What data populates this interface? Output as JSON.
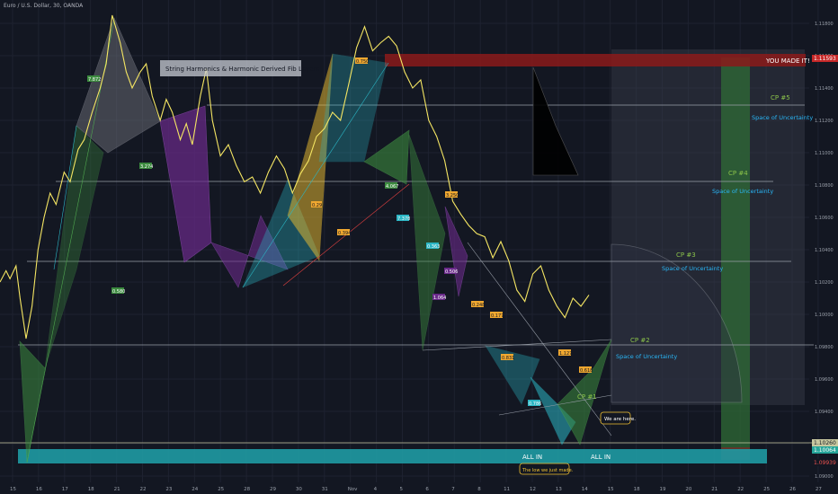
{
  "header": {
    "symbol_title": "Euro / U.S. Dollar, 30, OANDA"
  },
  "annotations": {
    "study_title": "String Harmonics & Harmonic Derived Fib Layers",
    "you_made_it": "YOU MADE IT!",
    "we_are_here": "We are here.",
    "low_we_just_made": "The low we just made.",
    "all_in": "ALL IN",
    "space_of_uncertainty": "Space of Uncertainty",
    "cp_labels": [
      "CP #1",
      "CP #2",
      "CP #3",
      "CP #4",
      "CP #5"
    ],
    "ratio_labels": [
      "7.872",
      "3.274",
      "0.580",
      "0.750",
      "0.29",
      "0.394",
      "4.067",
      "7.378",
      "0.363",
      "1.064",
      "0.506",
      "3.250",
      "0.248",
      "0.177",
      "0.831",
      "0.786",
      "1.127",
      "0.618"
    ]
  },
  "colors": {
    "background": "#131722",
    "price_line": "#f5e663",
    "green_pattern": "#3b8a3e",
    "purple_pattern": "#6a2a8a",
    "cyan_pattern": "#2bb6c4",
    "orange_pattern": "#f0a830",
    "red_band": "#8b1a1a",
    "teal_band": "#26a69a"
  },
  "chart_data": {
    "type": "line",
    "title": "Euro / U.S. Dollar, 30, OANDA",
    "xlabel": "",
    "ylabel": "",
    "x_tick_labels": [
      "15",
      "16",
      "17",
      "18",
      "21",
      "22",
      "23",
      "24",
      "25",
      "28",
      "29",
      "30",
      "31",
      "Nov",
      "4",
      "5",
      "6",
      "7",
      "8",
      "11",
      "12",
      "13",
      "14",
      "15",
      "18",
      "19",
      "20",
      "21",
      "22",
      "25",
      "26",
      "27"
    ],
    "y_tick_labels": [
      "1.11800",
      "1.11600",
      "1.11400",
      "1.11200",
      "1.11000",
      "1.10800",
      "1.10600",
      "1.10400",
      "1.10200",
      "1.10000",
      "1.09800",
      "1.09600",
      "1.09400",
      "1.09200",
      "1.09000"
    ],
    "ylim": [
      1.09,
      1.119
    ],
    "price_tags": [
      "1.11593",
      "1.10260",
      "1.10064",
      "1.09939"
    ],
    "series": [
      {
        "x": [
          15.0,
          15.3,
          15.5,
          15.8,
          16.0,
          16.3,
          16.6,
          16.9,
          17.2,
          17.5,
          17.8,
          18.2,
          18.5,
          18.9,
          19.2,
          19.6,
          20.0,
          20.3,
          20.6,
          21.0,
          21.3,
          21.6,
          22.0,
          22.3,
          22.6,
          23.0,
          23.3,
          23.6,
          24.0,
          24.3,
          24.6,
          25.0,
          25.3,
          25.6,
          26.0,
          26.4,
          26.8,
          27.2,
          27.6,
          28.0,
          28.4,
          28.8,
          29.2,
          29.6,
          30.0,
          30.4,
          30.8,
          31.2,
          31.6,
          32.0,
          32.4,
          32.8,
          33.2,
          33.6,
          34.0,
          34.4,
          34.8,
          35.2,
          35.6,
          36.0,
          36.4,
          36.8,
          37.2,
          37.6,
          38.0,
          38.4,
          38.8,
          39.2,
          39.6,
          40.0,
          40.4,
          40.8,
          41.2,
          41.6,
          42.0,
          42.4,
          42.8,
          43.2,
          43.6,
          44.0,
          44.4
        ],
        "y": [
          1.102,
          1.1027,
          1.1022,
          1.103,
          1.101,
          1.0985,
          1.1005,
          1.104,
          1.106,
          1.1075,
          1.1068,
          1.1088,
          1.1082,
          1.1102,
          1.1108,
          1.1125,
          1.114,
          1.1155,
          1.1185,
          1.1168,
          1.115,
          1.114,
          1.115,
          1.1155,
          1.1135,
          1.112,
          1.1133,
          1.1125,
          1.1108,
          1.1118,
          1.1105,
          1.1135,
          1.1152,
          1.112,
          1.1098,
          1.1105,
          1.1092,
          1.1082,
          1.1085,
          1.1075,
          1.1088,
          1.1098,
          1.109,
          1.1075,
          1.1087,
          1.1095,
          1.111,
          1.1115,
          1.1125,
          1.112,
          1.1142,
          1.1165,
          1.1178,
          1.1163,
          1.1168,
          1.1172,
          1.1166,
          1.115,
          1.114,
          1.1145,
          1.112,
          1.111,
          1.1095,
          1.107,
          1.1062,
          1.1055,
          1.105,
          1.1048,
          1.1035,
          1.1045,
          1.1033,
          1.1015,
          1.1008,
          1.1025,
          1.103,
          1.1015,
          1.1005,
          1.0998,
          1.101,
          1.1005,
          1.1012
        ]
      }
    ],
    "levels": [
      {
        "label": "CP #5",
        "value": 1.115
      },
      {
        "label": "CP #4",
        "value": 1.1124
      },
      {
        "label": "CP #3",
        "value": 1.109
      },
      {
        "label": "CP #2",
        "value": 1.1047
      },
      {
        "label": "CP #1",
        "value": 1.1021
      }
    ],
    "grid": true,
    "legend": "none"
  }
}
